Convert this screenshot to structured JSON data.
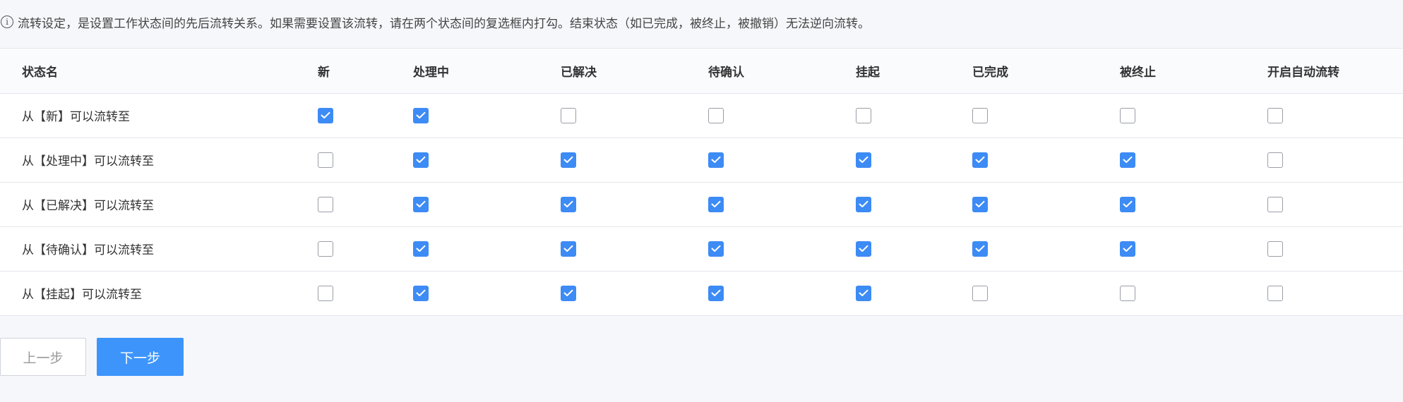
{
  "notice": {
    "icon": "info-icon",
    "text": "流转设定，是设置工作状态间的先后流转关系。如果需要设置该流转，请在两个状态间的复选框内打勾。结束状态（如已完成，被终止，被撤销）无法逆向流转。"
  },
  "table": {
    "headers": [
      "状态名",
      "新",
      "处理中",
      "已解决",
      "待确认",
      "挂起",
      "已完成",
      "被终止",
      "开启自动流转"
    ],
    "rows": [
      {
        "label": "从【新】可以流转至",
        "checks": [
          true,
          true,
          false,
          false,
          false,
          false,
          false,
          false
        ]
      },
      {
        "label": "从【处理中】可以流转至",
        "checks": [
          false,
          true,
          true,
          true,
          true,
          true,
          true,
          false
        ]
      },
      {
        "label": "从【已解决】可以流转至",
        "checks": [
          false,
          true,
          true,
          true,
          true,
          true,
          true,
          false
        ]
      },
      {
        "label": "从【待确认】可以流转至",
        "checks": [
          false,
          true,
          true,
          true,
          true,
          true,
          true,
          false
        ]
      },
      {
        "label": "从【挂起】可以流转至",
        "checks": [
          false,
          true,
          true,
          true,
          true,
          false,
          false,
          false
        ]
      }
    ]
  },
  "buttons": {
    "prev_label": "上一步",
    "next_label": "下一步"
  },
  "colors": {
    "checkbox_checked": "#3d8bf5",
    "primary_button": "#3d95fb",
    "page_background": "#f6f7fb"
  }
}
